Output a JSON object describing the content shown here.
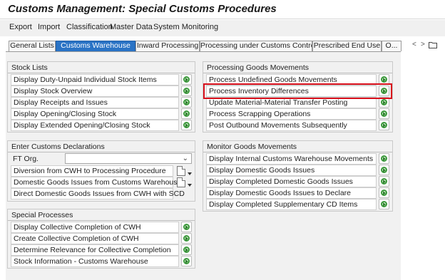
{
  "title": "Customs Management: Special Customs Procedures",
  "menu": [
    "Export",
    "Import",
    "Classification",
    "Master Data",
    "System Monitoring"
  ],
  "tabs": [
    {
      "label": "General Lists",
      "active": false
    },
    {
      "label": "Customs Warehouse",
      "active": true
    },
    {
      "label": "Inward Processing",
      "active": false
    },
    {
      "label": "Processing under Customs Control",
      "active": false
    },
    {
      "label": "Prescribed End Use",
      "active": false
    },
    {
      "label": "O...",
      "active": false
    }
  ],
  "tab_controls": {
    "prev": "<",
    "next": ">",
    "menu_icon": "folder-icon"
  },
  "groups": {
    "stock_lists": {
      "title": "Stock Lists",
      "items": [
        "Display Duty-Unpaid Individual Stock Items",
        "Display Stock Overview",
        "Display Receipts and Issues",
        "Display Opening/Closing Stock",
        "Display Extended Opening/Closing Stock"
      ]
    },
    "processing_goods": {
      "title": "Processing Goods Movements",
      "items": [
        "Process Undefined Goods Movements",
        "Process Inventory Differences",
        "Update Material-Material Transfer Posting",
        "Process Scrapping Operations",
        "Post Outbound Movements Subsequently"
      ],
      "highlighted_index": 1
    },
    "customs_declarations": {
      "title": "Enter Customs Declarations",
      "ft_org_label": "FT Org.",
      "ft_org_value": "",
      "items": [
        "Diversion from CWH to Processing Procedure",
        "Domestic Goods Issues from Customs Warehouse",
        "Direct Domestic Goods Issues from CWH with SCD"
      ]
    },
    "monitor_goods": {
      "title": "Monitor Goods Movements",
      "items": [
        "Display Internal Customs Warehouse Movements",
        "Display Domestic Goods Issues",
        "Display Completed Domestic Goods Issues",
        "Display Domestic Goods Issues to Declare",
        "Display Completed Supplementary CD Items"
      ]
    },
    "special_processes": {
      "title": "Special Processes",
      "items": [
        "Display Collective Completion of CWH",
        "Create Collective Completion of CWH",
        "Determine Relevance for Collective Completion",
        "Stock Information - Customs Warehouse"
      ]
    }
  },
  "colors": {
    "active_tab": "#2a73c5",
    "highlight": "#d9101c",
    "execute_icon": "#3c9a3c"
  }
}
